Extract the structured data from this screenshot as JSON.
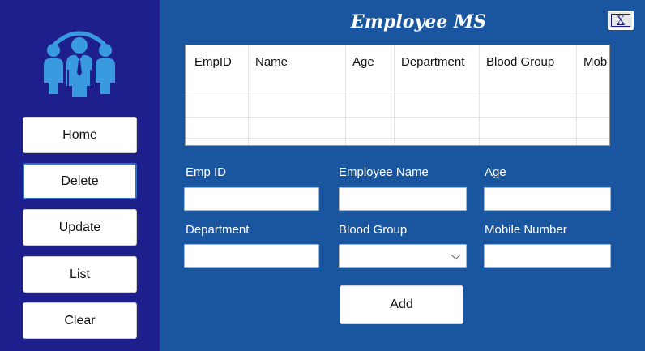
{
  "window": {
    "title": "Employee MS",
    "close_label": "X"
  },
  "sidebar": {
    "logo_icon": "team-people-icon",
    "items": [
      {
        "label": "Home"
      },
      {
        "label": "Delete"
      },
      {
        "label": "Update"
      },
      {
        "label": "List"
      },
      {
        "label": "Clear"
      }
    ],
    "active_item": "Delete"
  },
  "grid": {
    "columns": [
      "EmpID",
      "Name",
      "Age",
      "Department",
      "Blood Group",
      "Mob"
    ]
  },
  "form": {
    "emp_id": {
      "label": "Emp ID",
      "value": ""
    },
    "employee_name": {
      "label": "Employee Name",
      "value": ""
    },
    "age": {
      "label": "Age",
      "value": ""
    },
    "department": {
      "label": "Department",
      "value": ""
    },
    "blood_group": {
      "label": "Blood Group",
      "value": ""
    },
    "mobile_number": {
      "label": "Mobile Number",
      "value": ""
    },
    "add_label": "Add"
  },
  "colors": {
    "main_bg": "#1a56a0",
    "sidebar_bg": "#1c1f8c",
    "logo_color": "#3a9ae0"
  }
}
